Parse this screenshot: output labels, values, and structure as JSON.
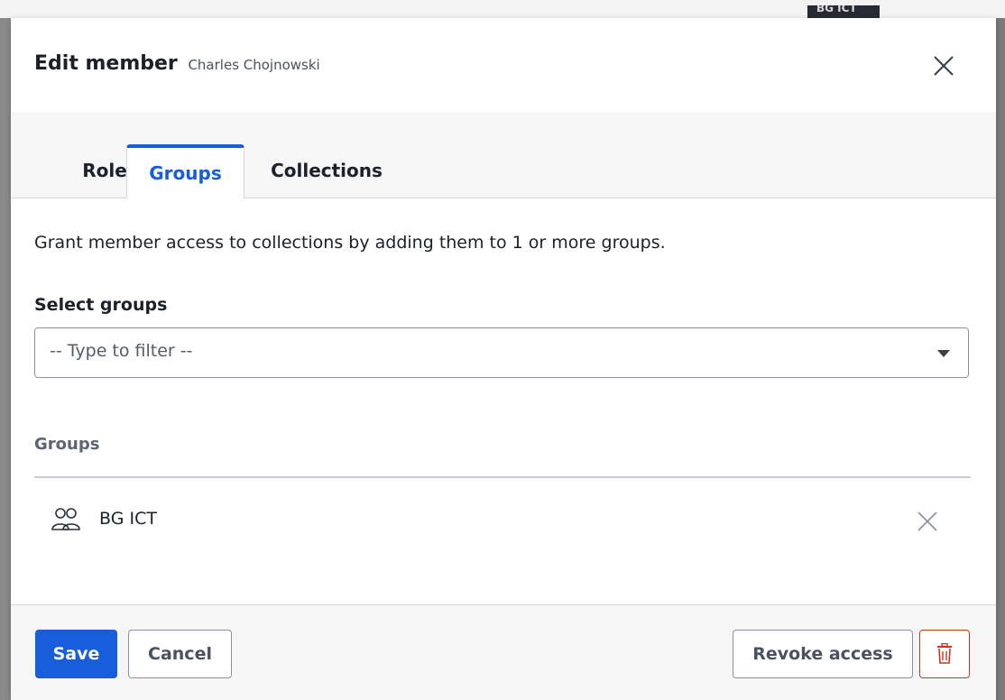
{
  "background": {
    "badge_text": "BG ICT"
  },
  "dialog": {
    "title": "Edit member",
    "subtitle": "Charles Chojnowski",
    "close_icon": "close-icon"
  },
  "tabs": [
    {
      "label": "Role",
      "active": false
    },
    {
      "label": "Groups",
      "active": true
    },
    {
      "label": "Collections",
      "active": false
    }
  ],
  "groups_tab": {
    "description": "Grant member access to collections by adding them to 1 or more groups.",
    "select_label": "Select groups",
    "select_placeholder": "-- Type to filter --",
    "table_header": "Groups",
    "rows": [
      {
        "name": "BG ICT",
        "icon": "users-icon"
      }
    ]
  },
  "footer": {
    "save_label": "Save",
    "cancel_label": "Cancel",
    "revoke_label": "Revoke access",
    "delete_icon": "trash-icon"
  },
  "colors": {
    "primary": "#175ddc",
    "danger": "#c83522",
    "text": "#1b2029",
    "muted": "#5a6473"
  }
}
